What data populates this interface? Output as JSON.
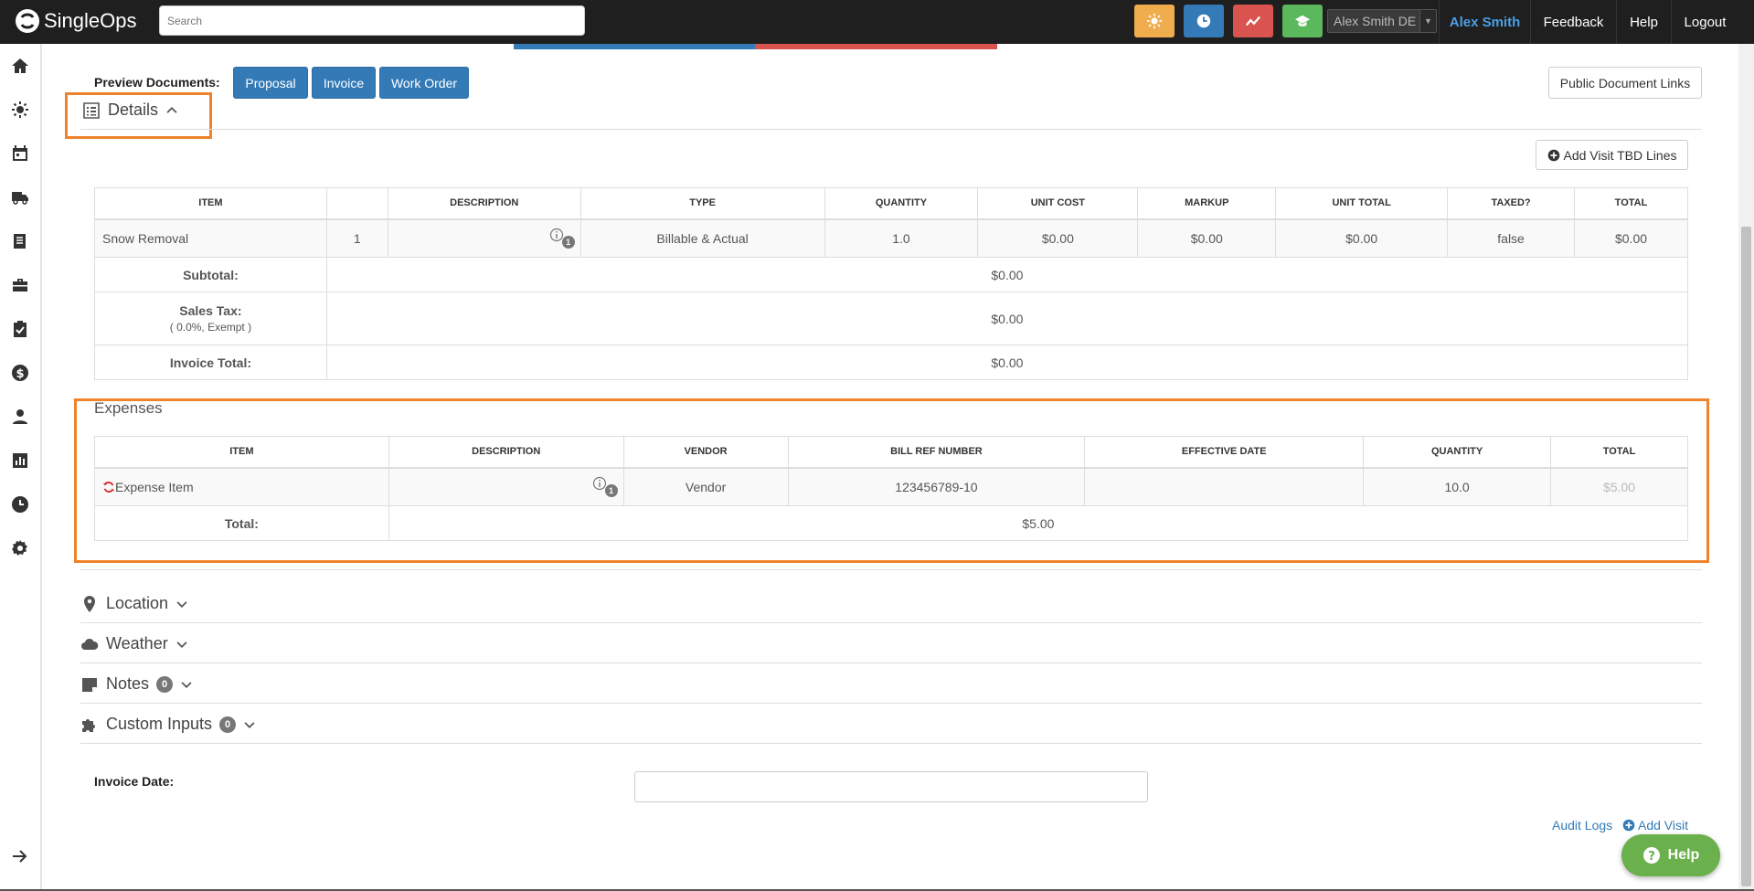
{
  "topbar": {
    "logo_text": "SingleOps",
    "search_placeholder": "Search",
    "quick_buttons": [
      {
        "name": "weather-button",
        "color": "#f0ad4e",
        "icon": "sun-icon"
      },
      {
        "name": "time-button",
        "color": "#337ab7",
        "icon": "clock-icon"
      },
      {
        "name": "reports-button",
        "color": "#d9534f",
        "icon": "trend-icon"
      },
      {
        "name": "training-button",
        "color": "#5cb85c",
        "icon": "graduation-cap-icon"
      }
    ],
    "user_select_value": "Alex Smith DE",
    "user_name": "Alex Smith",
    "feedback": "Feedback",
    "help": "Help",
    "logout": "Logout"
  },
  "sidebar": {
    "icons": [
      "home-icon",
      "sun-icon",
      "calendar-icon",
      "truck-icon",
      "list-icon",
      "briefcase-icon",
      "clipboard-check-icon",
      "dollar-icon",
      "user-icon",
      "bar-chart-icon",
      "clock-icon",
      "gear-icon",
      "arrow-right-icon"
    ]
  },
  "preview": {
    "label": "Preview Documents:",
    "proposal": "Proposal",
    "invoice": "Invoice",
    "work_order": "Work Order",
    "public_links": "Public Document Links"
  },
  "details": {
    "title": "Details",
    "add_tbd": "Add Visit TBD Lines",
    "headers": [
      "ITEM",
      "",
      "DESCRIPTION",
      "TYPE",
      "QUANTITY",
      "UNIT COST",
      "MARKUP",
      "UNIT TOTAL",
      "TAXED?",
      "TOTAL"
    ],
    "row": {
      "item": "Snow Removal",
      "num": "1",
      "info_badge": "1",
      "type": "Billable & Actual",
      "quantity": "1.0",
      "unit_cost": "$0.00",
      "markup": "$0.00",
      "unit_total": "$0.00",
      "taxed": "false",
      "total": "$0.00"
    },
    "subtotal_label": "Subtotal:",
    "subtotal_value": "$0.00",
    "tax_label": "Sales Tax:",
    "tax_note": "( 0.0%, Exempt )",
    "tax_value": "$0.00",
    "invoice_total_label": "Invoice Total:",
    "invoice_total_value": "$0.00"
  },
  "expenses": {
    "title": "Expenses",
    "headers": [
      "ITEM",
      "DESCRIPTION",
      "VENDOR",
      "BILL REF NUMBER",
      "EFFECTIVE DATE",
      "QUANTITY",
      "TOTAL"
    ],
    "row": {
      "item": "Expense Item",
      "info_badge": "1",
      "vendor": "Vendor",
      "bill_ref": "123456789-10",
      "effective_date": "",
      "quantity": "10.0",
      "total": "$5.00"
    },
    "total_label": "Total:",
    "total_value": "$5.00"
  },
  "sections": {
    "location": "Location",
    "weather": "Weather",
    "notes": "Notes",
    "notes_count": "0",
    "custom_inputs": "Custom Inputs",
    "custom_count": "0"
  },
  "invoice_date_label": "Invoice Date:",
  "links": {
    "audit_logs": "Audit Logs",
    "add_visit": "Add Visit"
  },
  "help_button": "Help",
  "colors": {
    "highlight": "#f0832a",
    "primary": "#337ab7",
    "help_green": "#6ab04c"
  }
}
